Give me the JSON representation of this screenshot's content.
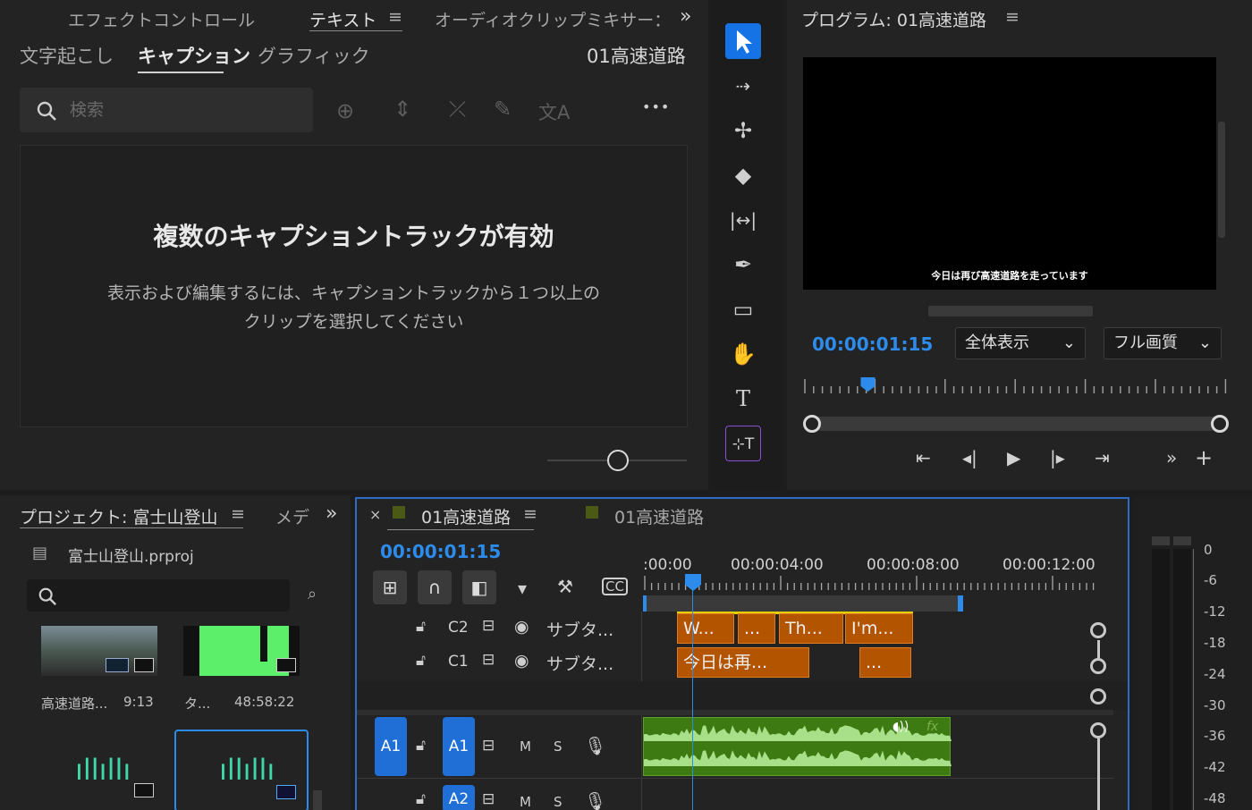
{
  "text_panel": {
    "tabs": [
      "エフェクトコントロール",
      "テキスト",
      "オーディオクリップミキサー："
    ],
    "overflow": "»",
    "subtabs": [
      "文字起こし",
      "キャプション",
      "グラフィック"
    ],
    "sequence_name": "01高速道路",
    "search_placeholder": "検索",
    "empty_title": "複数のキャプショントラックが有効",
    "empty_desc_line1": "表示および編集するには、キャプショントラックから１つ以上の",
    "empty_desc_line2": "クリップを選択してください",
    "more": "•••"
  },
  "program": {
    "title": "プログラム: 01高速道路",
    "subtitle_overlay": "今日は再び高速道路を走っています",
    "timecode": "00:00:01:15",
    "zoom": "全体表示",
    "quality": "フル画質",
    "playhead_fraction": 0.15
  },
  "project": {
    "title": "プロジェクト: 富士山登山",
    "tab2": "メデ",
    "overflow": "»",
    "file": "富士山登山.prproj",
    "items": [
      {
        "name": "高速道路...",
        "duration": "9:13"
      },
      {
        "name": "タ...",
        "duration": "48:58:22"
      }
    ]
  },
  "timeline": {
    "tab1": "01高速道路",
    "tab2": "01高速道路",
    "close": "×",
    "timecode": "00:00:01:15",
    "ruler": [
      ":00:00",
      "00:00:04:00",
      "00:00:08:00",
      "00:00:12:00"
    ],
    "tracks": {
      "c2": {
        "label": "C2",
        "name": "サブタ..."
      },
      "c1": {
        "label": "C1",
        "name": "サブタ..."
      },
      "a1": {
        "src": "A1",
        "label": "A1",
        "m": "M",
        "s": "S"
      },
      "a2": {
        "label": "A2",
        "m": "M",
        "s": "S"
      }
    },
    "c2_clips": [
      "W...",
      "...",
      "Th...",
      "I'm..."
    ],
    "c1_clips": [
      "今日は再...",
      "..."
    ],
    "fx": "fx"
  },
  "meter": {
    "labels": [
      "0",
      "-6",
      "-12",
      "-18",
      "-24",
      "-30",
      "-36",
      "-42",
      "-48"
    ]
  },
  "colors": {
    "accent": "#2d8ceb",
    "clip_orange": "#b35400",
    "audio_green": "#3e7a12",
    "badge_blue": "#1f6fd6"
  }
}
